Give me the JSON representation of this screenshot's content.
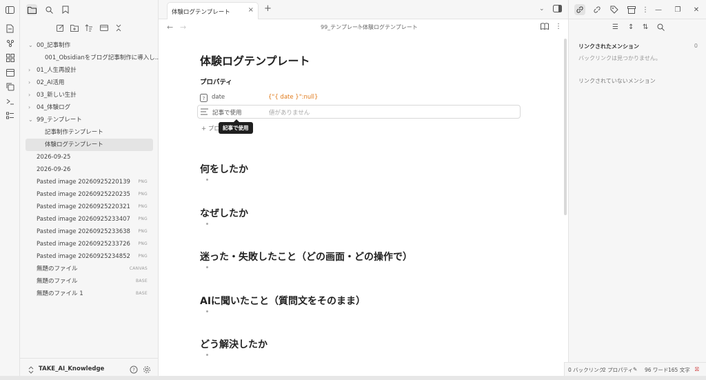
{
  "file_tree": [
    {
      "label": "00_記事制作",
      "type": "folder",
      "open": true,
      "depth": 0
    },
    {
      "label": "001_Obsidianをブログ記事制作に導入し...",
      "type": "file",
      "depth": 1
    },
    {
      "label": "01_人生再設計",
      "type": "folder",
      "open": false,
      "depth": 0
    },
    {
      "label": "02_AI活用",
      "type": "folder",
      "open": false,
      "depth": 0
    },
    {
      "label": "03_新しい生計",
      "type": "folder",
      "open": false,
      "depth": 0
    },
    {
      "label": "04_体験ログ",
      "type": "folder",
      "open": false,
      "depth": 0
    },
    {
      "label": "99_テンプレート",
      "type": "folder",
      "open": true,
      "depth": 0
    },
    {
      "label": "記事制作テンプレート",
      "type": "file",
      "depth": 1
    },
    {
      "label": "体験ログテンプレート",
      "type": "file",
      "depth": 1,
      "selected": true
    },
    {
      "label": "2026-09-25",
      "type": "file",
      "depth": 0
    },
    {
      "label": "2026-09-26",
      "type": "file",
      "depth": 0
    },
    {
      "label": "Pasted image 20260925220139",
      "type": "file",
      "depth": 0,
      "ext": "PNG"
    },
    {
      "label": "Pasted image 20260925220235",
      "type": "file",
      "depth": 0,
      "ext": "PNG"
    },
    {
      "label": "Pasted image 20260925220321",
      "type": "file",
      "depth": 0,
      "ext": "PNG"
    },
    {
      "label": "Pasted image 20260925233407",
      "type": "file",
      "depth": 0,
      "ext": "PNG"
    },
    {
      "label": "Pasted image 20260925233638",
      "type": "file",
      "depth": 0,
      "ext": "PNG"
    },
    {
      "label": "Pasted image 20260925233726",
      "type": "file",
      "depth": 0,
      "ext": "PNG"
    },
    {
      "label": "Pasted image 20260925234852",
      "type": "file",
      "depth": 0,
      "ext": "PNG"
    },
    {
      "label": "無題のファイル",
      "type": "file",
      "depth": 0,
      "ext": "CANVAS"
    },
    {
      "label": "無題のファイル",
      "type": "file",
      "depth": 0,
      "ext": "BASE"
    },
    {
      "label": "無題のファイル 1",
      "type": "file",
      "depth": 0,
      "ext": "BASE"
    }
  ],
  "vault": {
    "name": "TAKE_AI_Knowledge"
  },
  "tab": {
    "title": "体験ログテンプレート",
    "close": "×",
    "new": "+"
  },
  "breadcrumb": {
    "folder": "99_テンプレート",
    "sep": "/",
    "file": "体験ログテンプレート"
  },
  "doc": {
    "title": "体験ログテンプレート",
    "properties_label": "プロパティ",
    "properties": [
      {
        "key": "date",
        "value": "{\"{ date }\":null}",
        "color": "#e07a1a"
      },
      {
        "key": "記事で使用",
        "value": "値がありません",
        "color": "#aaaaaa"
      }
    ],
    "tooltip": "記事で使用",
    "add_property": "+ プロ",
    "headings": [
      "何をしたか",
      "なぜしたか",
      "迷った・失敗したこと（どの画面・どの操作で）",
      "AIに聞いたこと（質問文をそのまま）",
      "どう解決したか"
    ]
  },
  "right_panel": {
    "linked_title": "リンクされたメンション",
    "linked_count": "0",
    "no_backlinks": "バックリンクは見つかりません。",
    "unlinked_title": "リンクされていないメンション"
  },
  "status_bar": {
    "backlinks": "0 バックリンク",
    "properties": "2 プロパティ",
    "words": "96 ワード",
    "chars": "165 文字"
  },
  "icons": {
    "accent": "#e07a1a"
  }
}
